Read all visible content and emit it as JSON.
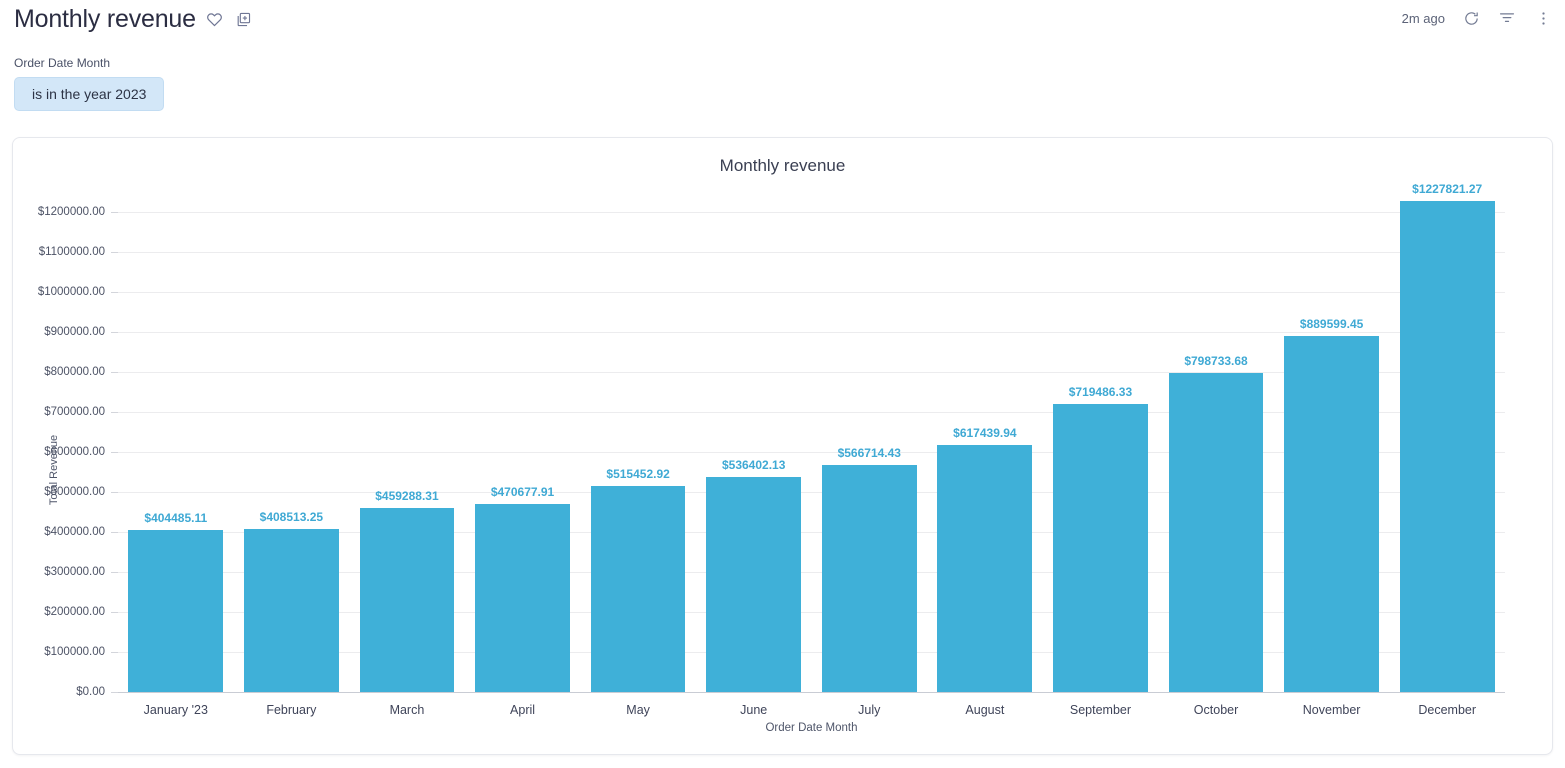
{
  "header": {
    "title": "Monthly revenue",
    "favorite_icon": "heart-icon",
    "add_to_dashboard_icon": "add-to-dashboard-icon",
    "last_run": "2m ago",
    "refresh_icon": "refresh-icon",
    "filter_icon": "filter-icon",
    "more_icon": "more-vertical-icon"
  },
  "filters": {
    "field_label": "Order Date Month",
    "chip_value": "is in the year 2023"
  },
  "card": {
    "chart_title": "Monthly revenue"
  },
  "colors": {
    "bar": "#3fb0d8",
    "label": "#3fa9d4",
    "chip_bg": "#d3e7f8",
    "grid": "#ececee"
  },
  "chart_data": {
    "type": "bar",
    "title": "Monthly revenue",
    "xlabel": "Order Date Month",
    "ylabel": "Total Revenue",
    "ylim": [
      0,
      1200000
    ],
    "grid": true,
    "legend": "none",
    "categories": [
      "January '23",
      "February",
      "March",
      "April",
      "May",
      "June",
      "July",
      "August",
      "September",
      "October",
      "November",
      "December"
    ],
    "values": [
      404485.11,
      408513.25,
      459288.31,
      470677.91,
      515452.92,
      536402.13,
      566714.43,
      617439.94,
      719486.33,
      798733.68,
      889599.45,
      1227821.27
    ],
    "data_labels": [
      "$404485.11",
      "$408513.25",
      "$459288.31",
      "$470677.91",
      "$515452.92",
      "$536402.13",
      "$566714.43",
      "$617439.94",
      "$719486.33",
      "$798733.68",
      "$889599.45",
      "$1227821.27"
    ],
    "ytick_values": [
      1200000,
      1100000,
      1000000,
      900000,
      800000,
      700000,
      600000,
      500000,
      400000,
      300000,
      200000,
      100000,
      0
    ],
    "ytick_labels": [
      "$1200000.00",
      "$1100000.00",
      "$1000000.00",
      "$900000.00",
      "$800000.00",
      "$700000.00",
      "$600000.00",
      "$500000.00",
      "$400000.00",
      "$300000.00",
      "$200000.00",
      "$100000.00",
      "$0.00"
    ]
  }
}
